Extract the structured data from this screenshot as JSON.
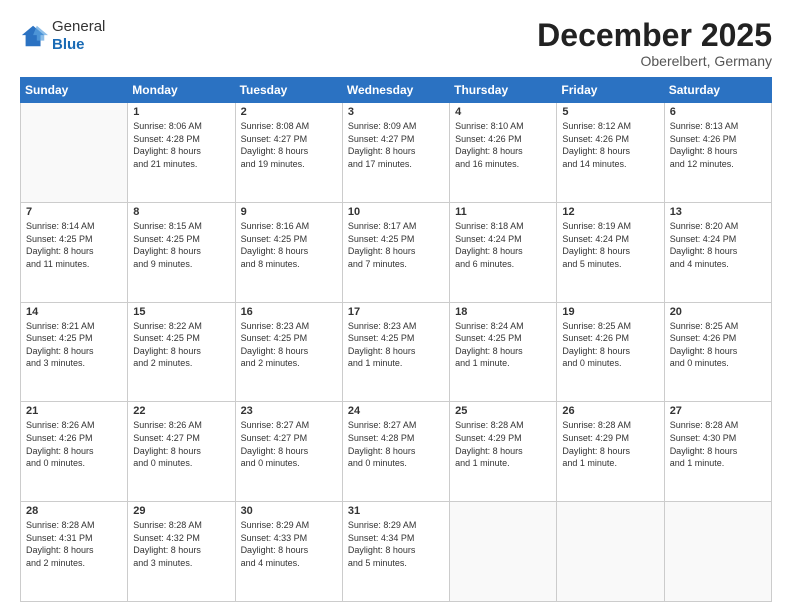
{
  "header": {
    "logo_general": "General",
    "logo_blue": "Blue",
    "month_title": "December 2025",
    "location": "Oberelbert, Germany"
  },
  "days_of_week": [
    "Sunday",
    "Monday",
    "Tuesday",
    "Wednesday",
    "Thursday",
    "Friday",
    "Saturday"
  ],
  "weeks": [
    [
      {
        "num": "",
        "info": ""
      },
      {
        "num": "1",
        "info": "Sunrise: 8:06 AM\nSunset: 4:28 PM\nDaylight: 8 hours\nand 21 minutes."
      },
      {
        "num": "2",
        "info": "Sunrise: 8:08 AM\nSunset: 4:27 PM\nDaylight: 8 hours\nand 19 minutes."
      },
      {
        "num": "3",
        "info": "Sunrise: 8:09 AM\nSunset: 4:27 PM\nDaylight: 8 hours\nand 17 minutes."
      },
      {
        "num": "4",
        "info": "Sunrise: 8:10 AM\nSunset: 4:26 PM\nDaylight: 8 hours\nand 16 minutes."
      },
      {
        "num": "5",
        "info": "Sunrise: 8:12 AM\nSunset: 4:26 PM\nDaylight: 8 hours\nand 14 minutes."
      },
      {
        "num": "6",
        "info": "Sunrise: 8:13 AM\nSunset: 4:26 PM\nDaylight: 8 hours\nand 12 minutes."
      }
    ],
    [
      {
        "num": "7",
        "info": "Sunrise: 8:14 AM\nSunset: 4:25 PM\nDaylight: 8 hours\nand 11 minutes."
      },
      {
        "num": "8",
        "info": "Sunrise: 8:15 AM\nSunset: 4:25 PM\nDaylight: 8 hours\nand 9 minutes."
      },
      {
        "num": "9",
        "info": "Sunrise: 8:16 AM\nSunset: 4:25 PM\nDaylight: 8 hours\nand 8 minutes."
      },
      {
        "num": "10",
        "info": "Sunrise: 8:17 AM\nSunset: 4:25 PM\nDaylight: 8 hours\nand 7 minutes."
      },
      {
        "num": "11",
        "info": "Sunrise: 8:18 AM\nSunset: 4:24 PM\nDaylight: 8 hours\nand 6 minutes."
      },
      {
        "num": "12",
        "info": "Sunrise: 8:19 AM\nSunset: 4:24 PM\nDaylight: 8 hours\nand 5 minutes."
      },
      {
        "num": "13",
        "info": "Sunrise: 8:20 AM\nSunset: 4:24 PM\nDaylight: 8 hours\nand 4 minutes."
      }
    ],
    [
      {
        "num": "14",
        "info": "Sunrise: 8:21 AM\nSunset: 4:25 PM\nDaylight: 8 hours\nand 3 minutes."
      },
      {
        "num": "15",
        "info": "Sunrise: 8:22 AM\nSunset: 4:25 PM\nDaylight: 8 hours\nand 2 minutes."
      },
      {
        "num": "16",
        "info": "Sunrise: 8:23 AM\nSunset: 4:25 PM\nDaylight: 8 hours\nand 2 minutes."
      },
      {
        "num": "17",
        "info": "Sunrise: 8:23 AM\nSunset: 4:25 PM\nDaylight: 8 hours\nand 1 minute."
      },
      {
        "num": "18",
        "info": "Sunrise: 8:24 AM\nSunset: 4:25 PM\nDaylight: 8 hours\nand 1 minute."
      },
      {
        "num": "19",
        "info": "Sunrise: 8:25 AM\nSunset: 4:26 PM\nDaylight: 8 hours\nand 0 minutes."
      },
      {
        "num": "20",
        "info": "Sunrise: 8:25 AM\nSunset: 4:26 PM\nDaylight: 8 hours\nand 0 minutes."
      }
    ],
    [
      {
        "num": "21",
        "info": "Sunrise: 8:26 AM\nSunset: 4:26 PM\nDaylight: 8 hours\nand 0 minutes."
      },
      {
        "num": "22",
        "info": "Sunrise: 8:26 AM\nSunset: 4:27 PM\nDaylight: 8 hours\nand 0 minutes."
      },
      {
        "num": "23",
        "info": "Sunrise: 8:27 AM\nSunset: 4:27 PM\nDaylight: 8 hours\nand 0 minutes."
      },
      {
        "num": "24",
        "info": "Sunrise: 8:27 AM\nSunset: 4:28 PM\nDaylight: 8 hours\nand 0 minutes."
      },
      {
        "num": "25",
        "info": "Sunrise: 8:28 AM\nSunset: 4:29 PM\nDaylight: 8 hours\nand 1 minute."
      },
      {
        "num": "26",
        "info": "Sunrise: 8:28 AM\nSunset: 4:29 PM\nDaylight: 8 hours\nand 1 minute."
      },
      {
        "num": "27",
        "info": "Sunrise: 8:28 AM\nSunset: 4:30 PM\nDaylight: 8 hours\nand 1 minute."
      }
    ],
    [
      {
        "num": "28",
        "info": "Sunrise: 8:28 AM\nSunset: 4:31 PM\nDaylight: 8 hours\nand 2 minutes."
      },
      {
        "num": "29",
        "info": "Sunrise: 8:28 AM\nSunset: 4:32 PM\nDaylight: 8 hours\nand 3 minutes."
      },
      {
        "num": "30",
        "info": "Sunrise: 8:29 AM\nSunset: 4:33 PM\nDaylight: 8 hours\nand 4 minutes."
      },
      {
        "num": "31",
        "info": "Sunrise: 8:29 AM\nSunset: 4:34 PM\nDaylight: 8 hours\nand 5 minutes."
      },
      {
        "num": "",
        "info": ""
      },
      {
        "num": "",
        "info": ""
      },
      {
        "num": "",
        "info": ""
      }
    ]
  ]
}
